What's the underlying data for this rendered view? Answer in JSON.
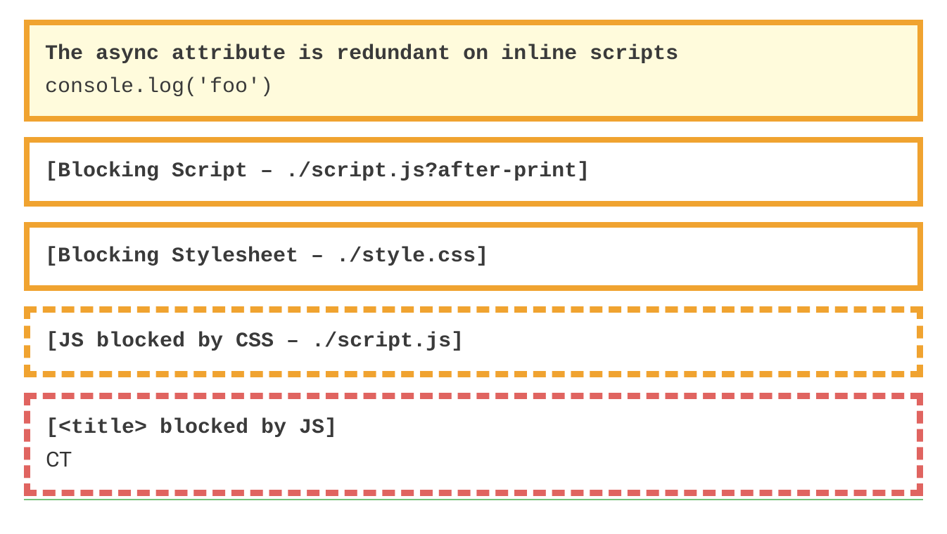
{
  "colors": {
    "orange_border": "#f0a330",
    "red_border": "#e06460",
    "warning_bg": "#fffbdc",
    "text": "#3a3a3a",
    "green_line": "#74c17a"
  },
  "blocks": [
    {
      "id": "warning-async-redundant",
      "border_style": "solid-orange",
      "background": "warn-bg",
      "lines": [
        {
          "text": "The async attribute is redundant on inline scripts",
          "bold": true,
          "font": "mono"
        },
        {
          "text": "console.log('foo')",
          "bold": false,
          "font": "mono"
        }
      ]
    },
    {
      "id": "blocking-script",
      "border_style": "solid-orange",
      "background": "white-bg",
      "lines": [
        {
          "text": "[Blocking Script – ./script.js?after-print]",
          "bold": true,
          "font": "mono"
        }
      ]
    },
    {
      "id": "blocking-stylesheet",
      "border_style": "solid-orange",
      "background": "white-bg",
      "lines": [
        {
          "text": "[Blocking Stylesheet – ./style.css]",
          "bold": true,
          "font": "mono"
        }
      ]
    },
    {
      "id": "js-blocked-by-css",
      "border_style": "dashed-orange",
      "background": "white-bg",
      "lines": [
        {
          "text": "[JS blocked by CSS – ./script.js]",
          "bold": true,
          "font": "mono"
        }
      ]
    },
    {
      "id": "title-blocked-by-js",
      "border_style": "dashed-red",
      "background": "white-bg",
      "lines": [
        {
          "text": "[<title> blocked by JS]",
          "bold": true,
          "font": "mono"
        },
        {
          "text": "CT",
          "bold": false,
          "font": "sans"
        }
      ]
    }
  ]
}
